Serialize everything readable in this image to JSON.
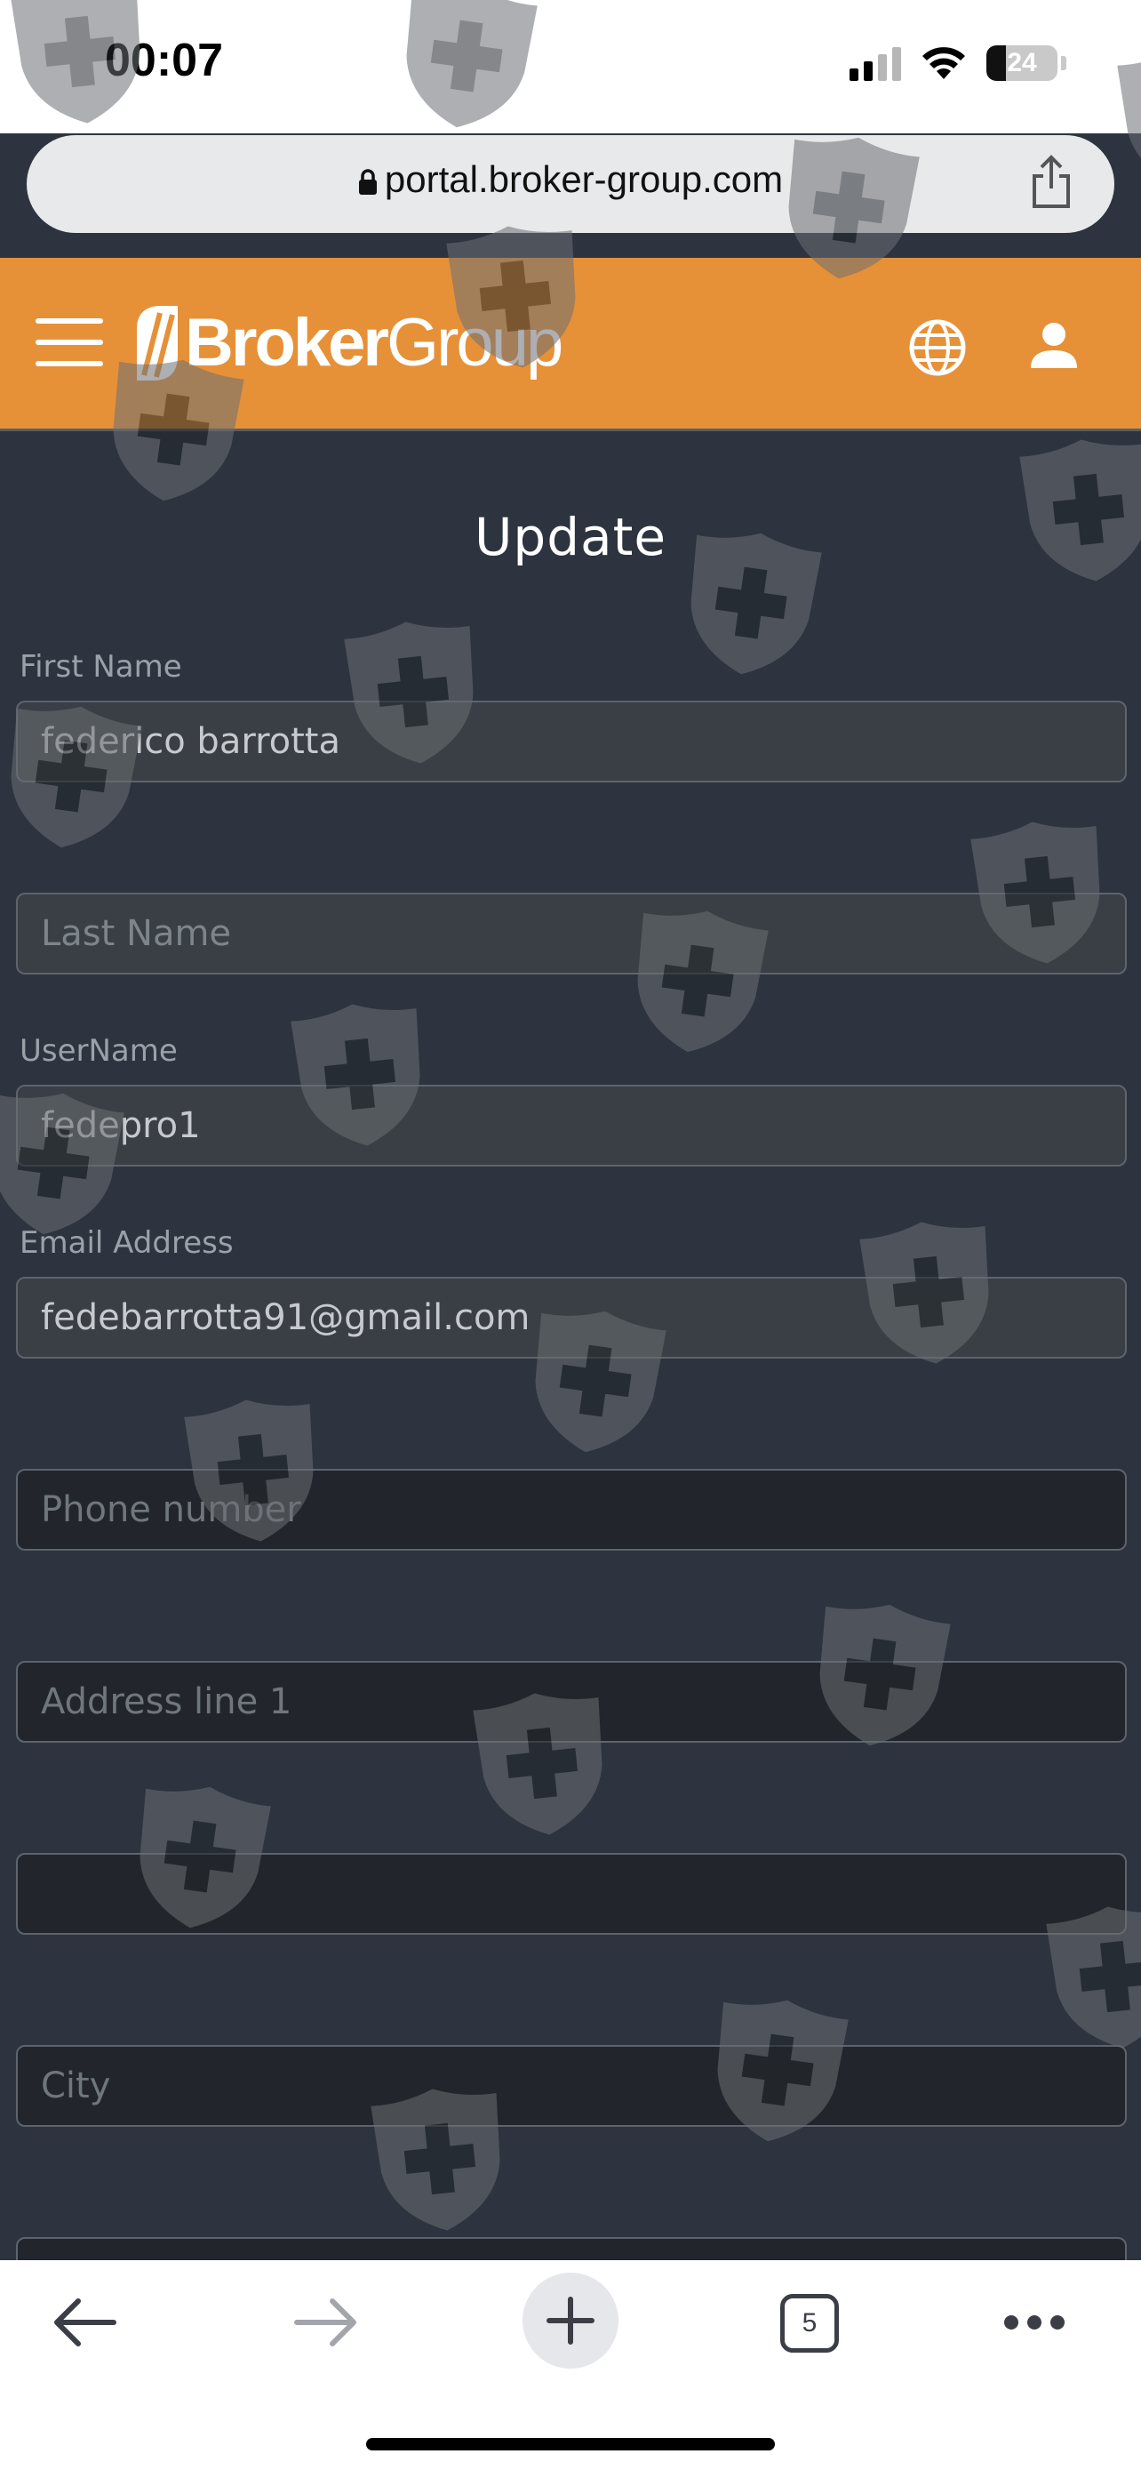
{
  "status_bar": {
    "time": "00:07",
    "battery": "24"
  },
  "browser": {
    "url": "portal.broker-group.com",
    "open_tabs": "5"
  },
  "header": {
    "logo_bold": "Broker",
    "logo_light": "Group",
    "brand_color": "#e69138"
  },
  "form": {
    "title": "Update",
    "first_name": {
      "label": "First Name",
      "value": "federico barrotta"
    },
    "last_name": {
      "placeholder": "Last Name"
    },
    "username": {
      "label": "UserName",
      "value": "fedepro1"
    },
    "email": {
      "label": "Email Address",
      "value": "fedebarrotta91@gmail.com"
    },
    "phone": {
      "placeholder": "Phone number"
    },
    "address1": {
      "placeholder": "Address line 1"
    },
    "address2": {
      "placeholder": ""
    },
    "city": {
      "placeholder": "City"
    }
  },
  "icons": {
    "watermark": "shield-plus-icon"
  }
}
